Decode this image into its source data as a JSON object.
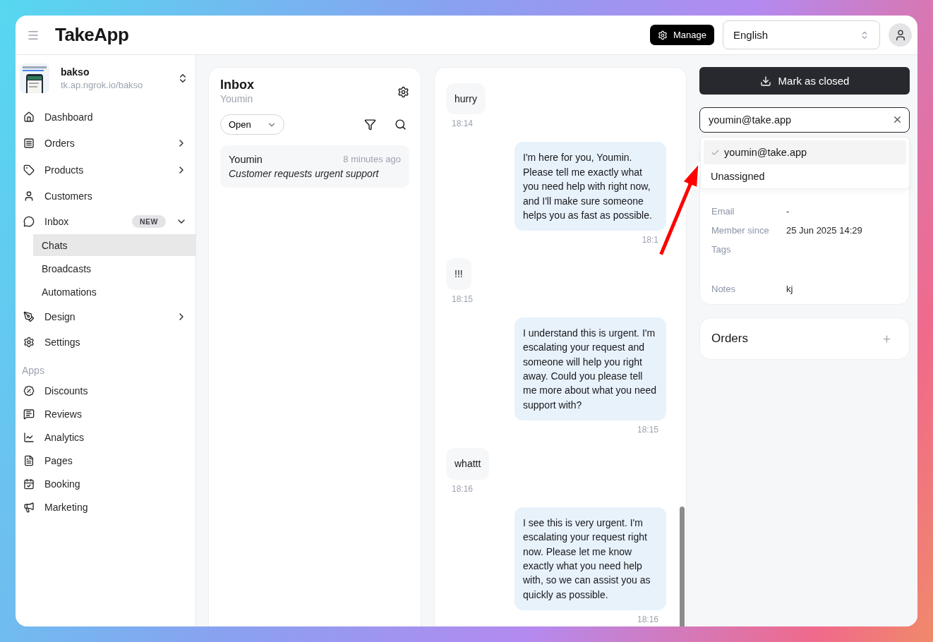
{
  "header": {
    "logo": "TakeApp",
    "manage_button": "Manage",
    "language": "English"
  },
  "store": {
    "name": "bakso",
    "url": "tk.ap.ngrok.io/bakso"
  },
  "nav": [
    {
      "kind": "link",
      "label": "Dashboard"
    },
    {
      "kind": "group",
      "label": "Orders",
      "expanded": false
    },
    {
      "kind": "group",
      "label": "Products",
      "expanded": false
    },
    {
      "kind": "link",
      "label": "Customers"
    },
    {
      "kind": "group",
      "label": "Inbox",
      "badge": "NEW",
      "expanded": true,
      "children": [
        {
          "label": "Chats",
          "selected": true
        },
        {
          "label": "Broadcasts",
          "selected": false
        },
        {
          "label": "Automations",
          "selected": false
        }
      ]
    },
    {
      "kind": "group",
      "label": "Design",
      "expanded": false
    },
    {
      "kind": "link",
      "label": "Settings"
    }
  ],
  "apps": {
    "title": "Apps",
    "items": [
      "Discounts",
      "Reviews",
      "Analytics",
      "Pages",
      "Booking",
      "Marketing"
    ]
  },
  "inbox": {
    "title": "Inbox",
    "subtitle": "Youmin",
    "status_filter": "Open",
    "conversations": [
      {
        "name": "Youmin",
        "time": "8 minutes ago",
        "preview": "Customer requests urgent support"
      }
    ]
  },
  "chat": {
    "messages": [
      {
        "kind": "customer",
        "text": "hurry",
        "time": "18:14"
      },
      {
        "kind": "agent",
        "text": "I'm here for you, Youmin. Please tell me exactly what you need help with right now, and I'll make sure someone helps you as fast as possible.",
        "time": "18:1"
      },
      {
        "kind": "customer",
        "text": "!!!",
        "time": "18:15"
      },
      {
        "kind": "agent",
        "text": "I understand this is urgent. I'm escalating your request and someone will help you right away. Could you please tell me more about what you need support with?",
        "time": "18:15"
      },
      {
        "kind": "customer",
        "text": "whattt",
        "time": "18:16"
      },
      {
        "kind": "agent",
        "text": "I see this is very urgent. I'm escalating your request right now. Please let me know exactly what you need help with, so we can assist you as quickly as possible.",
        "time": "18:16"
      }
    ]
  },
  "customer_panel": {
    "close_button": "Mark as closed",
    "assignee": {
      "value": "youmin@take.app",
      "options": [
        {
          "label": "youmin@take.app",
          "selected": true
        },
        {
          "label": "Unassigned",
          "selected": false
        }
      ]
    },
    "details": [
      {
        "label": "Email",
        "value": "-"
      },
      {
        "label": "Member since",
        "value": "25 Jun 2025 14:29"
      },
      {
        "label": "Tags"
      },
      {
        "label": "Notes",
        "value": "kj"
      }
    ],
    "orders": {
      "title": "Orders"
    }
  }
}
